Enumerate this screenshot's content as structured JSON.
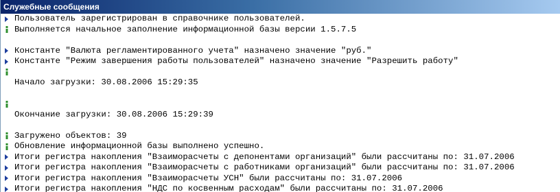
{
  "window": {
    "title": "Служебные сообщения"
  },
  "colors": {
    "arrow": "#1e3f9e",
    "info": "#2f8f2f",
    "title_bg": "#0a246a"
  },
  "messages": [
    {
      "icon": "arrow",
      "text": "Пользователь зарегистрирован в справочнике пользователей."
    },
    {
      "icon": "info",
      "text": "Выполняется начальное заполнение информационной базы версии 1.5.7.5"
    },
    {
      "icon": "none",
      "text": ""
    },
    {
      "icon": "arrow",
      "text": "Константе \"Валюта регламентированного учета\" назначено значение \"руб.\""
    },
    {
      "icon": "arrow",
      "text": "Константе \"Режим завершения работы пользователей\" назначено значение \"Разрешить работу\""
    },
    {
      "icon": "info",
      "text": ""
    },
    {
      "icon": "none",
      "text": "Начало загрузки:   30.08.2006 15:29:35"
    },
    {
      "icon": "none",
      "text": ""
    },
    {
      "icon": "info",
      "text": ""
    },
    {
      "icon": "none",
      "text": "Окончание загрузки: 30.08.2006 15:29:39"
    },
    {
      "icon": "none",
      "text": ""
    },
    {
      "icon": "info",
      "text": "Загружено объектов: 39"
    },
    {
      "icon": "info",
      "text": "Обновление информационной базы выполнено успешно."
    },
    {
      "icon": "arrow",
      "text": "Итоги регистра накопления \"Взаиморасчеты с депонентами организаций\" были рассчитаны по: 31.07.2006"
    },
    {
      "icon": "arrow",
      "text": "Итоги регистра накопления \"Взаиморасчеты с работниками организаций\" были рассчитаны по: 31.07.2006"
    },
    {
      "icon": "arrow",
      "text": "Итоги регистра накопления \"Взаиморасчеты УСН\" были рассчитаны по: 31.07.2006"
    },
    {
      "icon": "arrow",
      "text": "Итоги регистра накопления \"НДС по косвенным расходам\" были рассчитаны по: 31.07.2006"
    }
  ]
}
